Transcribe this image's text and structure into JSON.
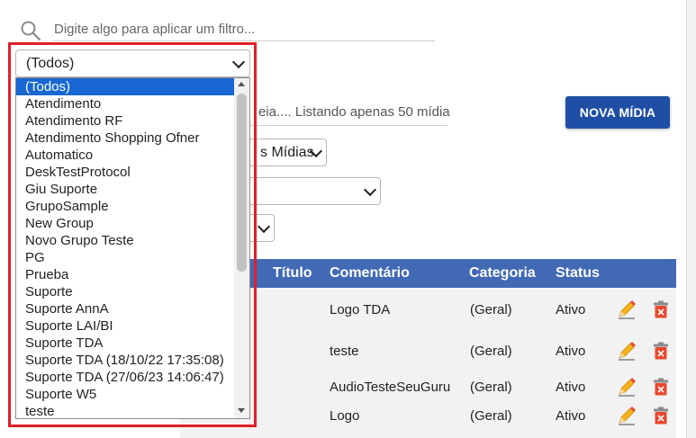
{
  "search": {
    "placeholder": "Digite algo para aplicar um filtro..."
  },
  "media_search": {
    "visible_text": "eia.... Listando apenas 50 mídia"
  },
  "nova_button": {
    "label": "NOVA MÍDIA"
  },
  "media_filter": {
    "visible_text": "s Mídias"
  },
  "group_select": {
    "value": "(Todos)",
    "options": [
      "(Todos)",
      "Atendimento",
      "Atendimento RF",
      "Atendimento Shopping Ofner",
      "Automatico",
      "DeskTestProtocol",
      "Giu Suporte",
      "GrupoSample",
      "New Group",
      "Novo Grupo Teste",
      "PG",
      "Prueba",
      "Suporte",
      "Suporte AnnA",
      "Suporte LAI/BI",
      "Suporte TDA",
      "Suporte TDA (18/10/22 17:35:08)",
      "Suporte TDA (27/06/23 14:06:47)",
      "Suporte W5",
      "teste"
    ]
  },
  "table": {
    "headers": {
      "titulo": "Título",
      "comentario": "Comentário",
      "categoria": "Categoria",
      "status": "Status"
    },
    "rows": [
      {
        "comentario": "Logo TDA",
        "categoria": "(Geral)",
        "status": "Ativo"
      },
      {
        "comentario": "teste",
        "categoria": "(Geral)",
        "status": "Ativo"
      },
      {
        "comentario": "AudioTesteSeuGuru",
        "categoria": "(Geral)",
        "status": "Ativo"
      },
      {
        "comentario": "Logo",
        "categoria": "(Geral)",
        "status": "Ativo"
      }
    ]
  },
  "colors": {
    "accent": "#1f4fa4",
    "table_header": "#4169b4",
    "highlight_frame": "#e0202a",
    "selected_option": "#1967d2"
  }
}
